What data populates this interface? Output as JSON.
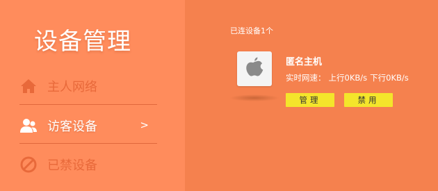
{
  "sidebar": {
    "title": "设备管理",
    "items": [
      {
        "label": "主人网络",
        "icon": "home-icon",
        "state": "inactive"
      },
      {
        "label": "访客设备",
        "icon": "guests-icon",
        "state": "active",
        "arrow": ">"
      },
      {
        "label": "已禁设备",
        "icon": "blocked-icon",
        "state": "inactive"
      }
    ]
  },
  "main": {
    "connected_count_text": "已连设备1个",
    "device": {
      "name": "匿名主机",
      "icon": "apple-icon",
      "speed_label": "实时网速：",
      "upload": "上行0KB/s",
      "download": "下行0KB/s"
    },
    "buttons": {
      "manage": "管理",
      "block": "禁用"
    }
  },
  "colors": {
    "sidebar_bg": "#FF8C5C",
    "main_bg": "#F5814E",
    "inactive_text": "#E8693A",
    "button_bg": "#F4E52B"
  }
}
